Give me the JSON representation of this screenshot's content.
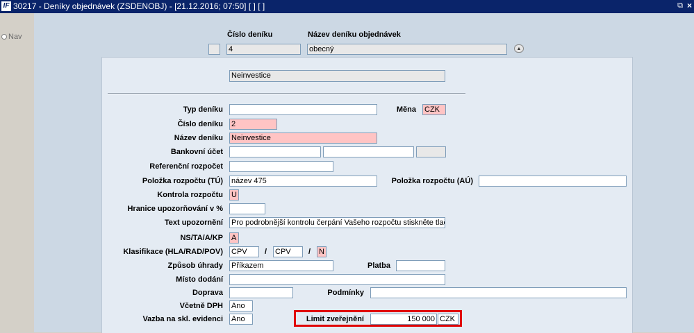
{
  "window": {
    "title": "30217 - Deníky objednávek (ZSDENOBJ) - [21.12.2016; 07:50]  [ ]  [ ]",
    "logo_text": "IF",
    "restore_glyph": "⧉",
    "close_glyph": "×"
  },
  "nav": {
    "label": "Nav"
  },
  "header": {
    "cislo_label": "Číslo deníku",
    "nazev_label": "Název deníku objednávek",
    "cislo_value": "4",
    "nazev_value": "obecný",
    "collapse_glyph": "▲"
  },
  "top_value": "Neinvestice",
  "form": {
    "typ_deniku": {
      "label": "Typ deníku",
      "value": ""
    },
    "mena": {
      "label": "Měna",
      "value": "CZK"
    },
    "cislo_deniku": {
      "label": "Číslo deníku",
      "value": "2"
    },
    "nazev_deniku": {
      "label": "Název deníku",
      "value": "Neinvestice"
    },
    "bankovni_ucet": {
      "label": "Bankovní účet",
      "values": [
        "",
        "",
        ""
      ]
    },
    "referencni_rozpocet": {
      "label": "Referenční rozpočet",
      "value": ""
    },
    "polozka_tu": {
      "label": "Položka rozpočtu (TÚ)",
      "value": "název 475"
    },
    "polozka_au": {
      "label": "Položka rozpočtu (AÚ)",
      "value": ""
    },
    "kontrola_rozpoctu": {
      "label": "Kontrola rozpočtu",
      "value": "U"
    },
    "hranice": {
      "label": "Hranice upozorňování v %",
      "value": ""
    },
    "text_upozorneni": {
      "label": "Text upozornění",
      "value": "Pro podrobnější kontrolu čerpání Vašeho rozpočtu stiskněte tlač"
    },
    "ns_ta": {
      "label": "NS/TA/A/KP",
      "value": "A"
    },
    "klasifikace": {
      "label": "Klasifikace (HLA/RAD/POV)",
      "v1": "CPV",
      "v2": "CPV",
      "v3": "N",
      "slash": "/"
    },
    "zpusob_uhrady": {
      "label": "Způsob úhrady",
      "value": "Příkazem"
    },
    "platba": {
      "label": "Platba",
      "value": ""
    },
    "misto_dodani": {
      "label": "Místo dodání",
      "value": ""
    },
    "doprava": {
      "label": "Doprava",
      "value": ""
    },
    "podminky": {
      "label": "Podmínky",
      "value": ""
    },
    "vcetne_dph": {
      "label": "Včetně DPH",
      "value": "Ano"
    },
    "vazba": {
      "label": "Vazba na skl. evidenci",
      "value": "Ano"
    },
    "limit": {
      "label": "Limit zveřejnění",
      "value": "150 000",
      "currency": "CZK"
    }
  },
  "colors": {
    "title_bar": "#0a246a",
    "required_field": "#ffc4c4",
    "highlight_border": "#e00000",
    "panel": "#e4ebf3",
    "background": "#ccd8e4"
  }
}
